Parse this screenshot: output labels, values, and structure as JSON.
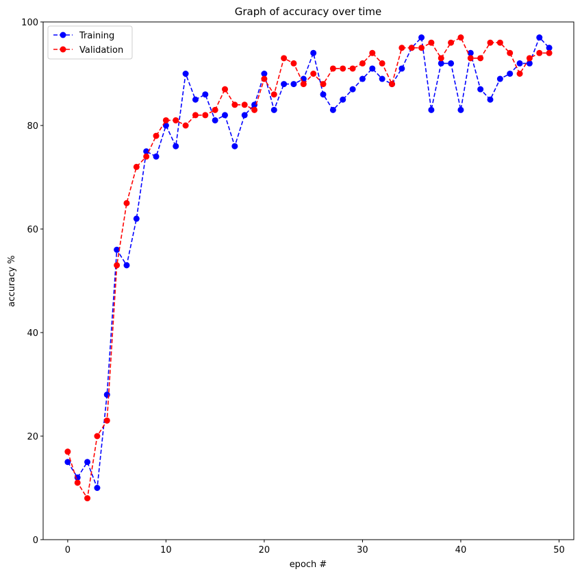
{
  "chart_data": {
    "type": "line",
    "title": "Graph of accuracy over time",
    "xlabel": "epoch #",
    "ylabel": "accuracy %",
    "xlim": [
      -2.5,
      51.5
    ],
    "ylim": [
      0,
      100
    ],
    "xticks": [
      0,
      10,
      20,
      30,
      40,
      50
    ],
    "yticks": [
      0,
      20,
      40,
      60,
      80,
      100
    ],
    "grid": false,
    "legend_position": "top-left",
    "x": [
      0,
      1,
      2,
      3,
      4,
      5,
      6,
      7,
      8,
      9,
      10,
      11,
      12,
      13,
      14,
      15,
      16,
      17,
      18,
      19,
      20,
      21,
      22,
      23,
      24,
      25,
      26,
      27,
      28,
      29,
      30,
      31,
      32,
      33,
      34,
      35,
      36,
      37,
      38,
      39,
      40,
      41,
      42,
      43,
      44,
      45,
      46,
      47,
      48,
      49
    ],
    "series": [
      {
        "name": "Training",
        "color": "#0000ff",
        "style": "dashed-with-circle-markers",
        "values": [
          15,
          12,
          15,
          10,
          28,
          56,
          53,
          62,
          75,
          74,
          80,
          76,
          90,
          85,
          86,
          81,
          82,
          76,
          82,
          84,
          90,
          83,
          88,
          88,
          89,
          94,
          86,
          83,
          85,
          87,
          89,
          91,
          89,
          88,
          91,
          95,
          97,
          83,
          92,
          92,
          83,
          94,
          87,
          85,
          89,
          90,
          92,
          92,
          97,
          95
        ]
      },
      {
        "name": "Validation",
        "color": "#ff0000",
        "style": "dashed-with-circle-markers",
        "values": [
          17,
          11,
          8,
          20,
          23,
          53,
          65,
          72,
          74,
          78,
          81,
          81,
          80,
          82,
          82,
          83,
          87,
          84,
          84,
          83,
          89,
          86,
          93,
          92,
          88,
          90,
          88,
          91,
          91,
          91,
          92,
          94,
          92,
          88,
          95,
          95,
          95,
          96,
          93,
          96,
          97,
          93,
          93,
          96,
          96,
          94,
          90,
          93,
          94,
          94
        ]
      }
    ]
  }
}
